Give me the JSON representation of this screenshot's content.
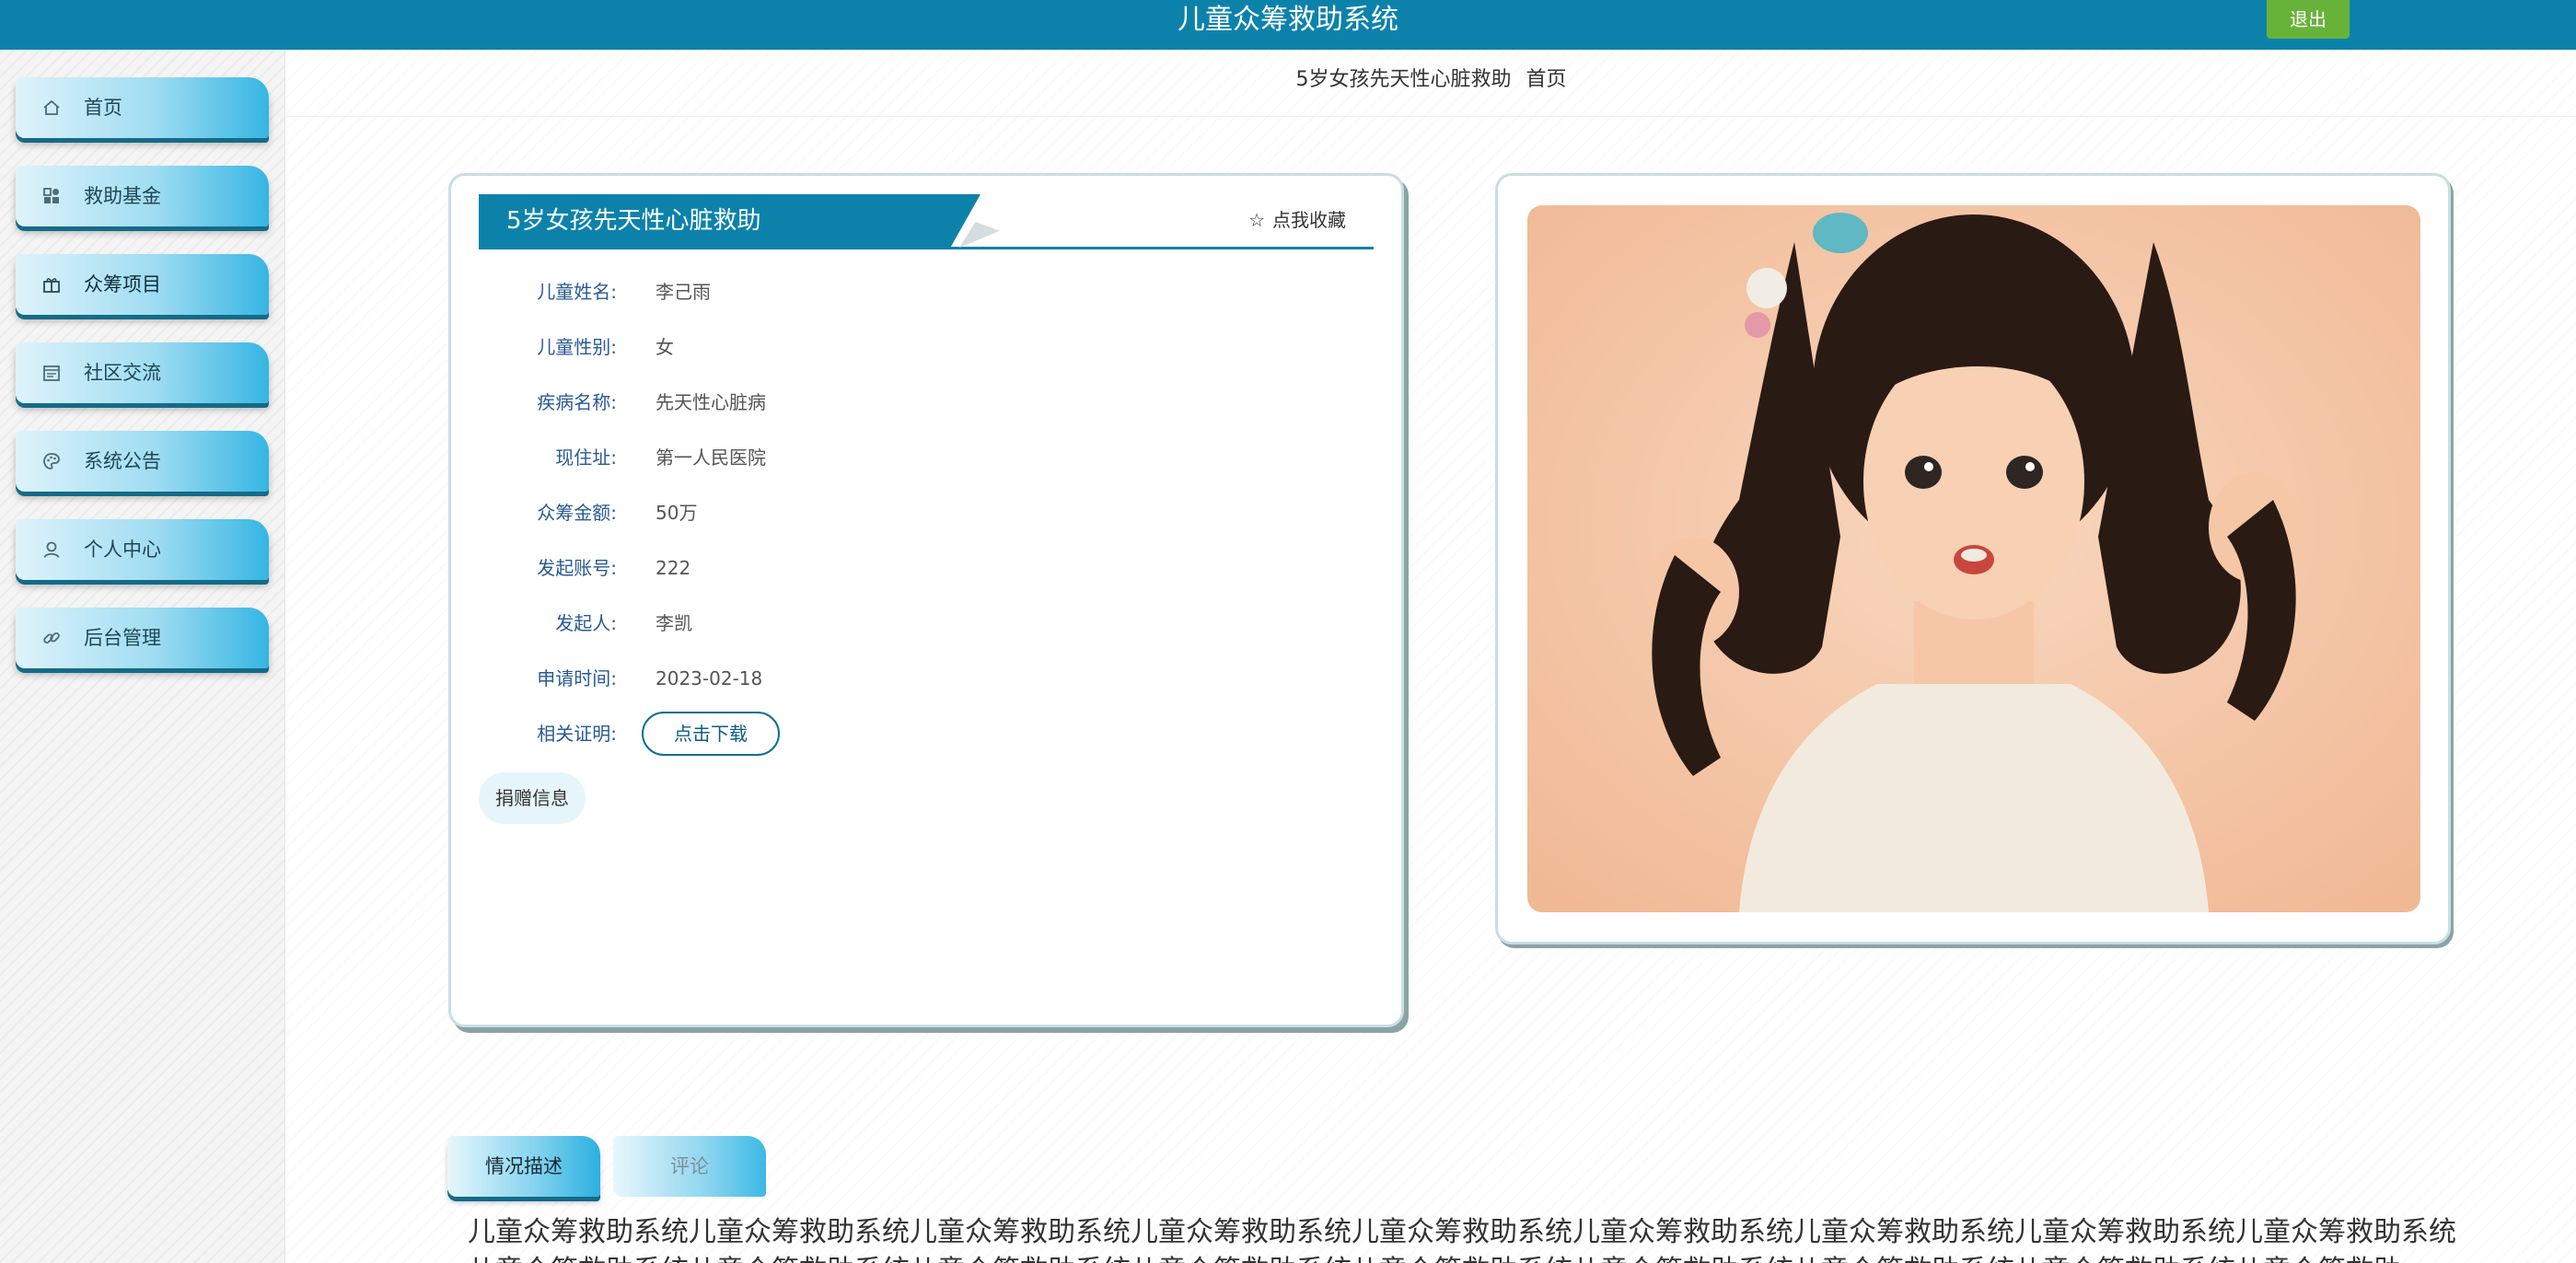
{
  "header": {
    "title": "儿童众筹救助系统",
    "logout_label": "退出"
  },
  "sidebar": {
    "items": [
      {
        "label": "首页",
        "icon": "home-icon"
      },
      {
        "label": "救助基金",
        "icon": "grid-icon"
      },
      {
        "label": "众筹项目",
        "icon": "gift-icon"
      },
      {
        "label": "社区交流",
        "icon": "calendar-icon"
      },
      {
        "label": "系统公告",
        "icon": "palette-icon"
      },
      {
        "label": "个人中心",
        "icon": "user-icon"
      },
      {
        "label": "后台管理",
        "icon": "link-icon"
      }
    ]
  },
  "breadcrumb": {
    "current": "5岁女孩先天性心脏救助",
    "home": "首页"
  },
  "project": {
    "title": "5岁女孩先天性心脏救助",
    "favorite_label": "点我收藏",
    "fields": [
      {
        "label": "儿童姓名:",
        "value": "李己雨"
      },
      {
        "label": "儿童性别:",
        "value": "女"
      },
      {
        "label": "疾病名称:",
        "value": "先天性心脏病"
      },
      {
        "label": "现住址:",
        "value": "第一人民医院"
      },
      {
        "label": "众筹金额:",
        "value": "50万"
      },
      {
        "label": "发起账号:",
        "value": "222"
      },
      {
        "label": "发起人:",
        "value": "李凯"
      },
      {
        "label": "申请时间:",
        "value": "2023-02-18"
      }
    ],
    "proof_label": "相关证明:",
    "download_label": "点击下载",
    "donation_info_label": "捐赠信息"
  },
  "tabs": {
    "description": "情况描述",
    "comments": "评论"
  },
  "description_text": "儿童众筹救助系统儿童众筹救助系统儿童众筹救助系统儿童众筹救助系统儿童众筹救助系统儿童众筹救助系统儿童众筹救助系统儿童众筹救助系统儿童众筹救助系统儿童众筹救助系统儿童众筹救助系统儿童众筹救助系统儿童众筹救助系统儿童众筹救助系统儿童众筹救助系统儿童众筹救助系统儿童众筹救助系统儿童众筹救助"
}
